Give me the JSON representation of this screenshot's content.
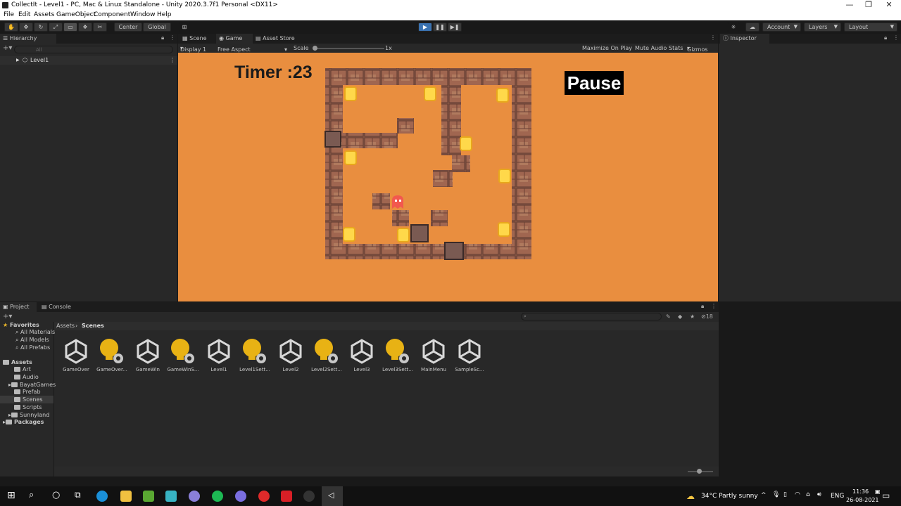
{
  "window": {
    "title": "CollectIt - Level1 - PC, Mac & Linux Standalone - Unity 2020.3.7f1 Personal <DX11>"
  },
  "menu": [
    "File",
    "Edit",
    "Assets",
    "GameObject",
    "Component",
    "Window",
    "Help"
  ],
  "toolbar": {
    "pivot_mode": "Center",
    "pivot_rotation": "Global",
    "account": "Account",
    "layers": "Layers",
    "layout": "Layout"
  },
  "hierarchy": {
    "tab": "Hierarchy",
    "search_placeholder": "All",
    "root_item": "Level1"
  },
  "center_tabs": {
    "scene": "Scene",
    "game": "Game",
    "asset_store": "Asset Store"
  },
  "game_bar": {
    "display": "Display 1",
    "aspect": "Free Aspect",
    "scale_label": "Scale",
    "scale_value": "1x",
    "maximize": "Maximize On Play",
    "mute": "Mute Audio",
    "stats": "Stats",
    "gizmos": "Gizmos"
  },
  "game": {
    "timer_text": "Timer :23",
    "pause_label": "Pause",
    "background_color": "#e98e3f"
  },
  "inspector": {
    "tab": "Inspector"
  },
  "bottom_tabs": {
    "project": "Project",
    "console": "Console"
  },
  "project": {
    "hidden_count": "18",
    "breadcrumb_root": "Assets",
    "breadcrumb_current": "Scenes",
    "favorites_label": "Favorites",
    "favorites": [
      "All Materials",
      "All Models",
      "All Prefabs"
    ],
    "assets_label": "Assets",
    "folders": [
      "Art",
      "Audio",
      "BayatGames",
      "Prefab",
      "Scenes",
      "Scripts",
      "Sunnyland"
    ],
    "packages_label": "Packages",
    "items": [
      {
        "label": "GameOver",
        "icon": "unity-scene-icon"
      },
      {
        "label": "GameOver...",
        "icon": "lighting-settings-icon"
      },
      {
        "label": "GameWin",
        "icon": "unity-scene-icon"
      },
      {
        "label": "GameWinS...",
        "icon": "lighting-settings-icon"
      },
      {
        "label": "Level1",
        "icon": "unity-scene-icon"
      },
      {
        "label": "Level1Sett...",
        "icon": "lighting-settings-icon"
      },
      {
        "label": "Level2",
        "icon": "unity-scene-icon"
      },
      {
        "label": "Level2Sett...",
        "icon": "lighting-settings-icon"
      },
      {
        "label": "Level3",
        "icon": "unity-scene-icon"
      },
      {
        "label": "Level3Sett...",
        "icon": "lighting-settings-icon"
      },
      {
        "label": "MainMenu",
        "icon": "unity-scene-icon"
      },
      {
        "label": "SampleSc...",
        "icon": "unity-scene-icon"
      }
    ]
  },
  "taskbar": {
    "weather": "34°C  Partly sunny",
    "language": "ENG",
    "time": "11:36",
    "date": "26-08-2021"
  }
}
